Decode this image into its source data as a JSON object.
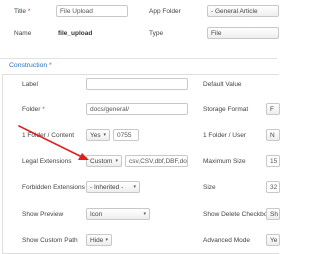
{
  "header": {
    "title_label": "Title",
    "title_required": "*",
    "title_value": "File Upload",
    "app_folder_label": "App Folder",
    "app_folder_value": "- General Article",
    "name_label": "Name",
    "name_value": "file_upload",
    "type_label": "Type",
    "type_value": "File"
  },
  "construction": {
    "section_title": "Construction",
    "section_required": "*",
    "label_label": "Label",
    "label_value": "",
    "default_value_label": "Default Value",
    "folder_label": "Folder",
    "folder_required": "*",
    "folder_value": "docs/general/",
    "storage_format_label": "Storage Format",
    "storage_format_value": "F",
    "folder_content_label": "1 Folder / Content",
    "folder_content_select": "Yes",
    "folder_content_perms": "0755",
    "folder_user_label": "1 Folder / User",
    "folder_user_value": "N",
    "legal_ext_label": "Legal Extensions",
    "legal_ext_select": "Custom",
    "legal_ext_value": "csv,CSV,dbf,DBF,do",
    "max_size_label": "Maximum Size",
    "max_size_value": "15",
    "forbidden_ext_label": "Forbidden Extensions",
    "forbidden_ext_select": "- Inherited -",
    "size_label": "Size",
    "size_value": "32",
    "show_preview_label": "Show Preview",
    "show_preview_select": "Icon",
    "show_delete_label": "Show Delete Checkbox",
    "show_delete_value": "Sh",
    "show_custom_path_label": "Show Custom Path",
    "show_custom_path_select": "Hide",
    "advanced_mode_label": "Advanced Mode",
    "advanced_mode_value": "Ye"
  },
  "icons": {
    "caret": "▾"
  },
  "colors": {
    "arrow": "#e02020",
    "section_title": "#2a6ebb",
    "required": "#d04040"
  }
}
